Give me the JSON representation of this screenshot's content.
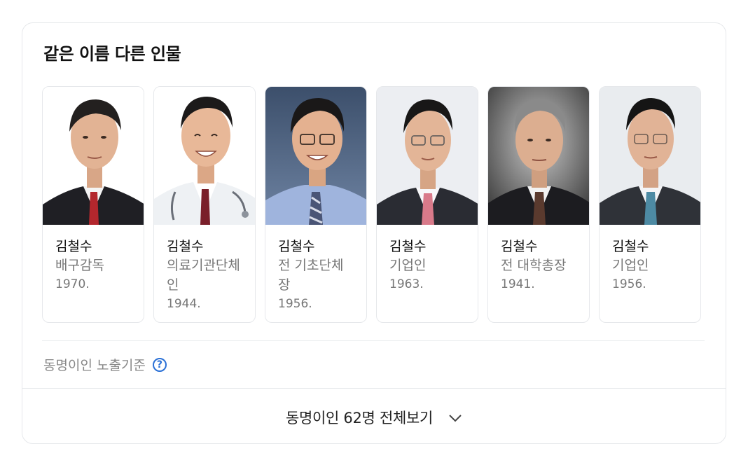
{
  "section": {
    "title": "같은 이름 다른 인물",
    "criteria_label": "동명이인 노출기준",
    "help_icon": "question-circle-icon",
    "more_label": "동명이인 62명 전체보기",
    "more_icon": "chevron-down-icon"
  },
  "colors": {
    "accent": "#2a70d6",
    "muted_text": "#777777",
    "border": "#e6e8eb"
  },
  "people": [
    {
      "name": "김철수",
      "job": "배구감독",
      "year": "1970."
    },
    {
      "name": "김철수",
      "job": "의료기관단체인",
      "year": "1944."
    },
    {
      "name": "김철수",
      "job": "전 기초단체장",
      "year": "1956."
    },
    {
      "name": "김철수",
      "job": "기업인",
      "year": "1963."
    },
    {
      "name": "김철수",
      "job": "전 대학총장",
      "year": "1941."
    },
    {
      "name": "김철수",
      "job": "기업인",
      "year": "1956."
    }
  ]
}
